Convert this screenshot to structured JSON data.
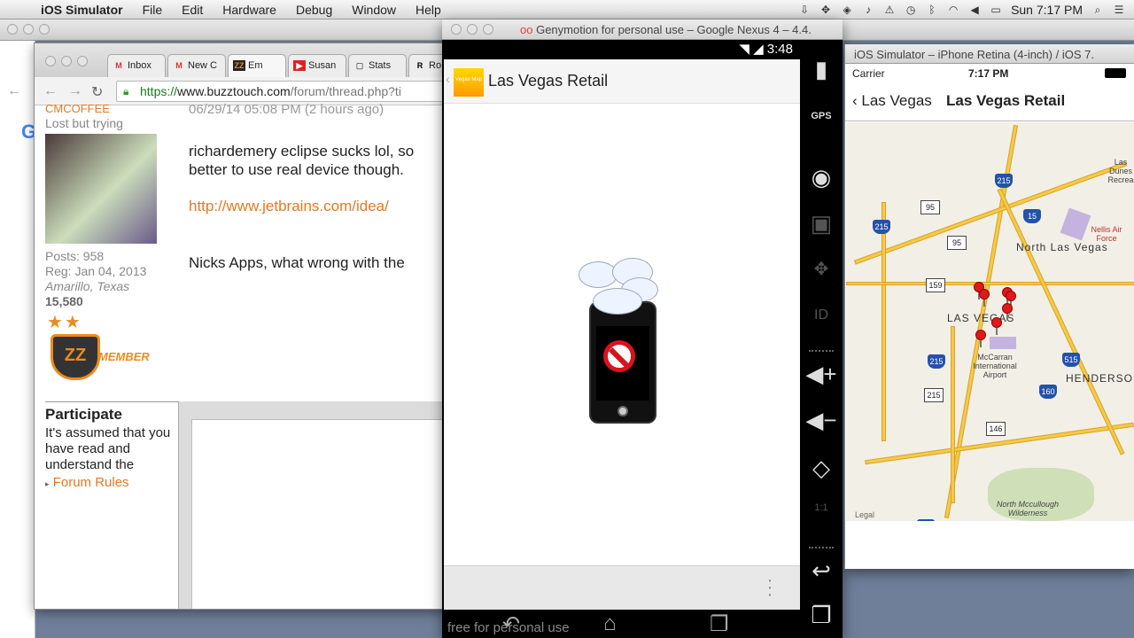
{
  "menubar": {
    "apple": "",
    "app": "iOS Simulator",
    "items": [
      "File",
      "Edit",
      "Hardware",
      "Debug",
      "Window",
      "Help"
    ],
    "clock": "Sun 7:17 PM"
  },
  "chrome": {
    "tabs": [
      {
        "icon": "M",
        "label": "Inbox"
      },
      {
        "icon": "M",
        "label": "New C"
      },
      {
        "icon": "ZZ",
        "label": "Em"
      },
      {
        "icon": "▶",
        "label": "Susan"
      },
      {
        "icon": "▢",
        "label": "Stats"
      },
      {
        "icon": "R",
        "label": "Ro"
      }
    ],
    "url_scheme": "https://",
    "url_host": "www.buzztouch.com",
    "url_path": "/forum/thread.php?ti"
  },
  "post": {
    "username": "CMCOFFEE",
    "user_title": "Lost but trying",
    "posts": "Posts: 958",
    "reg": "Reg: Jan 04, 2013",
    "location": "Amarillo, Texas",
    "points": "15,580",
    "member": "MEMBER",
    "badge": "ZZ",
    "timestamp": "06/29/14 05:08 PM (2 hours ago)",
    "line1": "richardemery eclipse sucks lol, so",
    "line2": "better to use real device though.",
    "link": "http://www.jetbrains.com/idea/",
    "line3": "Nicks Apps, what wrong with the"
  },
  "participate": {
    "heading": "Participate",
    "text": "It's assumed that you have read and understand the",
    "rules_link": "Forum Rules"
  },
  "genymotion": {
    "window_title": "Genymotion for personal use – Google Nexus 4 – 4.4.",
    "time": "3:48",
    "app_title": "Las Vegas Retail",
    "logo_text": "Vegas Map",
    "watermark": "free for personal use",
    "side_buttons": [
      "battery",
      "gps",
      "camera",
      "media",
      "move",
      "id",
      "vol-up",
      "vol-down",
      "rotate",
      "scale",
      "back",
      "recent",
      "menu"
    ],
    "gps_label": "GPS",
    "id_label": "ID",
    "scale_label": "1:1"
  },
  "ios": {
    "window_title": "iOS Simulator – iPhone Retina (4-inch) / iOS 7.",
    "carrier": "Carrier",
    "time": "7:17 PM",
    "back_label": "Las Vegas",
    "title": "Las Vegas Retail",
    "map": {
      "city": "LAS VEGAS",
      "north": "North Las Vegas",
      "henderson": "HENDERSO",
      "airport": "McCarran International Airport",
      "nellis": "Nellis Air Force",
      "dunes": "Las Dunes Recrea",
      "wilderness": "North Mccullough Wilderness",
      "legal": "Legal",
      "routes": [
        "215",
        "95",
        "15",
        "215",
        "95",
        "159",
        "215",
        "515",
        "160",
        "215",
        "146",
        "15"
      ]
    }
  }
}
